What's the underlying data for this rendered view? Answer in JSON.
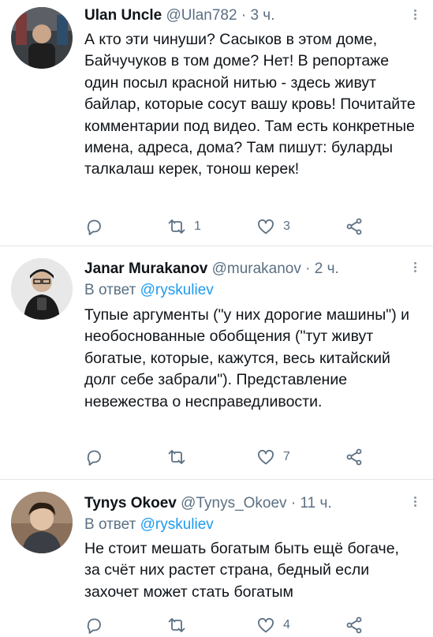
{
  "tweets": [
    {
      "name": "Ulan Uncle",
      "handle": "@Ulan782",
      "separator": "·",
      "time": "3 ч.",
      "reply_label": "",
      "reply_mention": "",
      "text": "А кто эти чинуши? Сасыков в этом доме, Байчучуков в том доме? Нет! В репортаже один посыл красной нитью - здесь живут байлар,  которые сосут вашу кровь! Почитайте комментарии под видео. Там есть конкретные имена, адреса, дома? Там пишут: буларды талкалаш керек, тонош керек!",
      "reply_count": "",
      "retweet_count": "1",
      "like_count": "3"
    },
    {
      "name": "Janar Murakanov",
      "handle": "@murakanov",
      "separator": "·",
      "time": "2 ч.",
      "reply_label": "В ответ ",
      "reply_mention": "@ryskuliev",
      "text": "Тупые аргументы (\"у них дорогие машины\") и необоснованные обобщения (\"тут живут богатые, которые, кажутся, весь китайский долг себе забрали\"). Представление невежества о несправедливости.",
      "reply_count": "",
      "retweet_count": "",
      "like_count": "7"
    },
    {
      "name": "Tynys Okoev",
      "handle": "@Tynys_Okoev",
      "separator": "·",
      "time": "11 ч.",
      "reply_label": "В ответ ",
      "reply_mention": "@ryskuliev",
      "text": "Не стоит мешать богатым быть ещё богаче, за счёт них растет страна, бедный если захочет может стать богатым",
      "reply_count": "",
      "retweet_count": "",
      "like_count": "4"
    }
  ],
  "icons": {
    "reply": "reply-icon",
    "retweet": "retweet-icon",
    "like": "like-icon",
    "share": "share-icon",
    "more": "more-options-icon"
  },
  "colors": {
    "text": "#0f1419",
    "secondary": "#5b7083",
    "mention": "#1d9bf0",
    "divider": "#e6e6e6"
  }
}
